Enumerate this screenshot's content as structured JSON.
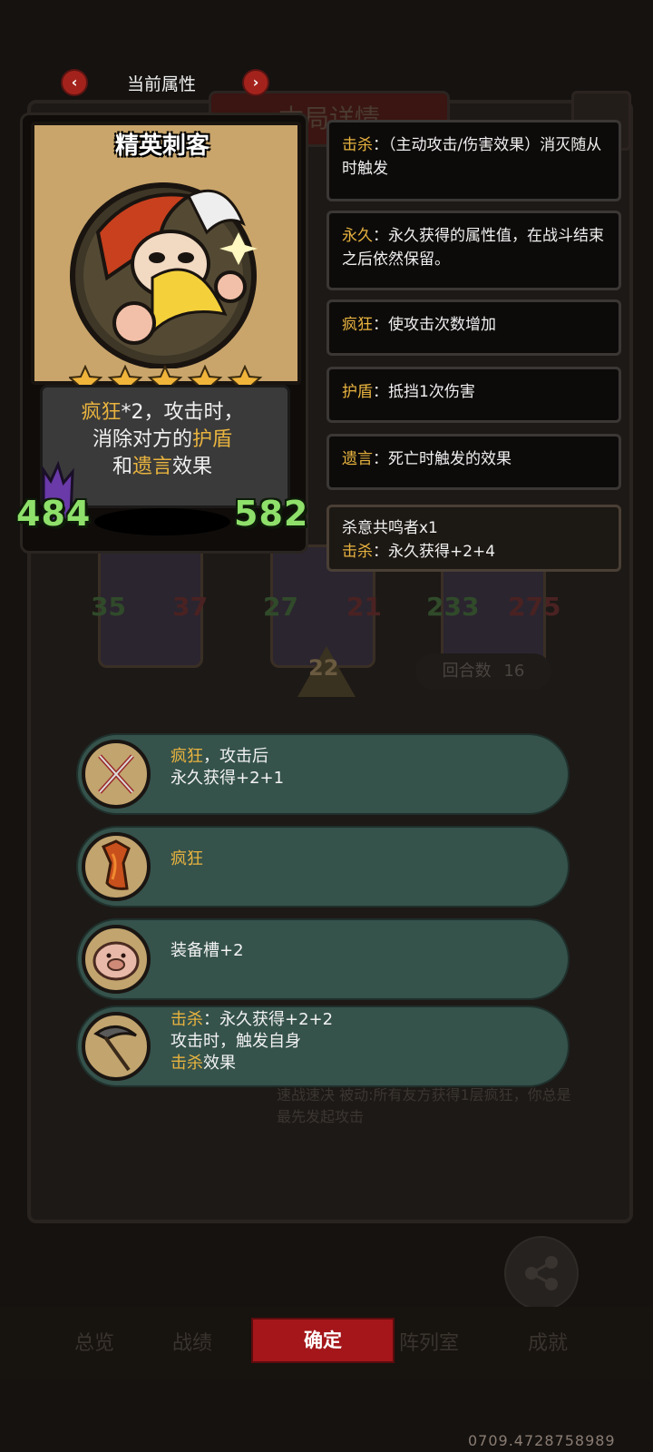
{
  "nav": {
    "prev_label": "‹",
    "next_label": "›",
    "title": "当前属性"
  },
  "background": {
    "title_partial": "本局详情",
    "rounds_label": "回合数",
    "rounds_value": "16",
    "arrow_value": "22",
    "unit_stats": [
      {
        "atk": "35",
        "hp": "37"
      },
      {
        "atk": "27",
        "hp": "21"
      },
      {
        "atk": "233",
        "hp": "275"
      }
    ],
    "skill_text": "速战速决 被动:所有友方获得1层疯狂，你总是最先发起攻击",
    "share_label": "分享",
    "tabs": [
      "总览",
      "战绩",
      "阵列室",
      "成就"
    ]
  },
  "hero": {
    "name": "精英刺客",
    "stars": 5,
    "desc_kw1": "疯狂",
    "desc_mid1": "*2，攻击时，",
    "desc_mid2": "消除对方的",
    "desc_kw2": "护盾",
    "desc_mid3": "和",
    "desc_kw3": "遗言",
    "desc_end": "效果",
    "attack": "484",
    "health": "582"
  },
  "keywords": [
    {
      "key": "击杀",
      "text": "：（主动攻击/伤害效果）消灭随从时触发"
    },
    {
      "key": "永久",
      "text": "：永久获得的属性值，在战斗结束之后依然保留。"
    },
    {
      "key": "疯狂",
      "text": "：使攻击次数增加"
    },
    {
      "key": "护盾",
      "text": "：抵挡1次伤害"
    },
    {
      "key": "遗言",
      "text": "：死亡时触发的效果"
    }
  ],
  "resonance": {
    "title": "杀意共鸣者x1",
    "key": "击杀",
    "text": "：永久获得+2+4"
  },
  "equipment": [
    {
      "icon": "crossed-blades-icon",
      "kw": "疯狂",
      "line1": "，攻击后",
      "line2": "永久获得+2+1"
    },
    {
      "icon": "flame-cloak-icon",
      "kw": "疯狂",
      "line1": "",
      "line2": ""
    },
    {
      "icon": "pig-armor-icon",
      "text": "装备槽+2"
    },
    {
      "icon": "scythe-icon",
      "kw": "击杀",
      "line1": "：永久获得+2+2",
      "line2": "攻击时，触发自身",
      "kw2": "击杀",
      "line3": "效果"
    }
  ],
  "confirm_label": "确定",
  "footer_id": "0709.4728758989",
  "colors": {
    "keyword": "#e8b33f",
    "stat_green": "#8ee06b",
    "confirm_red": "#a4161a",
    "equip_bar": "#35524b"
  }
}
